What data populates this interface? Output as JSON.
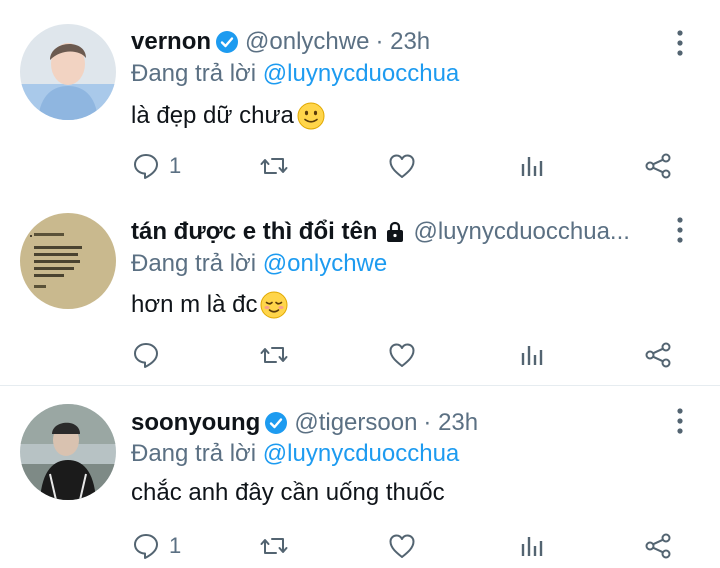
{
  "reply_prefix": "Đang trả lời",
  "tweets": [
    {
      "name": "vernon",
      "verified": true,
      "handle": "@onlychwe",
      "time": "· 23h",
      "reply_to": "@luynycduocchua",
      "text": "là đẹp dữ chưa",
      "emoji": "slight-smile",
      "reply_count": "1"
    },
    {
      "name": "tán được e thì đổi tên",
      "verified": false,
      "protected": true,
      "handle": "@luynycduocchua...",
      "time": "",
      "reply_to": "@onlychwe",
      "text": "hơn m là đc",
      "emoji": "relieved",
      "reply_count": ""
    },
    {
      "name": "soonyoung",
      "verified": true,
      "handle": "@tigersoon",
      "time": "· 23h",
      "reply_to": "@luynycduocchua",
      "text": "chắc anh đây cần uống thuốc",
      "emoji": "",
      "reply_count": "1"
    }
  ],
  "colors": {
    "accent": "#1d9bf0",
    "secondary_text": "#5b7083",
    "icon": "#536471",
    "divider": "#e6ecf0"
  }
}
